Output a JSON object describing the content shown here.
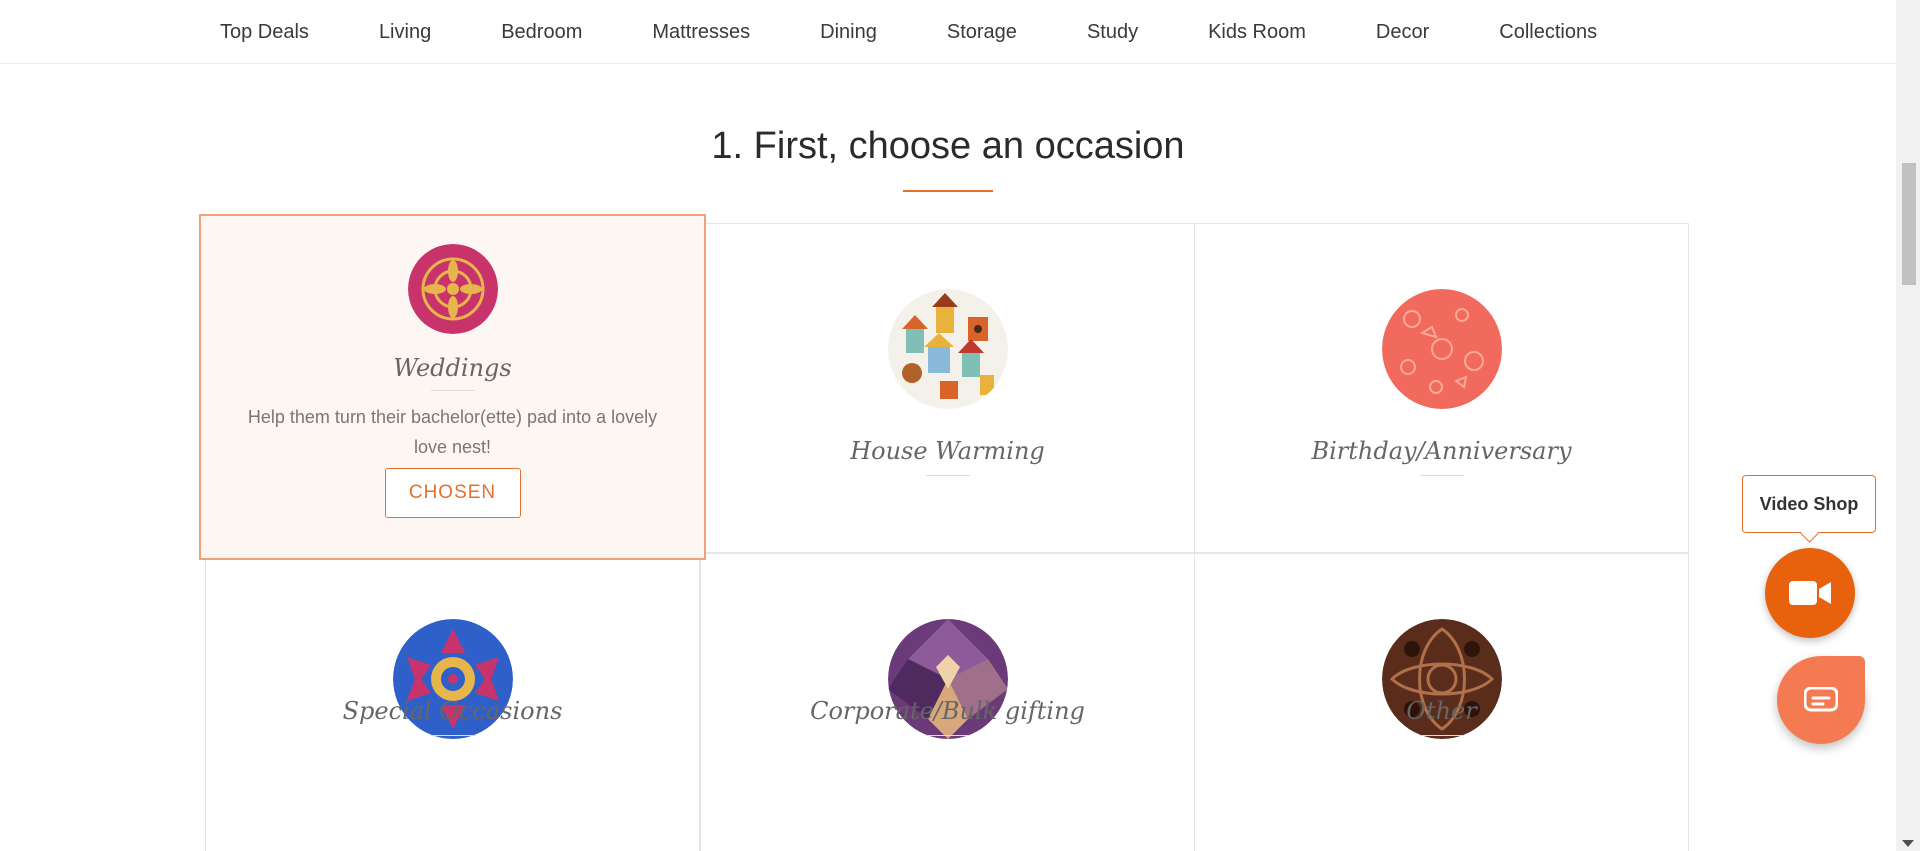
{
  "nav": {
    "items": [
      "Top Deals",
      "Living",
      "Bedroom",
      "Mattresses",
      "Dining",
      "Storage",
      "Study",
      "Kids Room",
      "Decor",
      "Collections"
    ]
  },
  "section": {
    "title": "1. First, choose an occasion"
  },
  "occasions": [
    {
      "name": "Weddings",
      "description": "Help them turn their bachelor(ette) pad into a lovely love nest!",
      "button": "CHOSEN",
      "selected": true,
      "icon": "wedding-pattern-icon",
      "color": "#c8336c"
    },
    {
      "name": "House Warming",
      "icon": "birdhouses-pattern-icon",
      "color": "#f4f1ea"
    },
    {
      "name": "Birthday/Anniversary",
      "icon": "party-pattern-icon",
      "color": "#f26a5e"
    },
    {
      "name": "Special Occasions",
      "icon": "kaleidoscope-pattern-icon",
      "color": "#2f5fc9"
    },
    {
      "name": "Corporate/Bulk gifting",
      "icon": "geometric-pattern-icon",
      "color": "#6b3a78"
    },
    {
      "name": "Other",
      "icon": "paisley-pattern-icon",
      "color": "#5a2c1c"
    }
  ],
  "floating": {
    "tooltip": "Video Shop",
    "accent": "#e8620e",
    "chat_color": "#f47a52"
  }
}
